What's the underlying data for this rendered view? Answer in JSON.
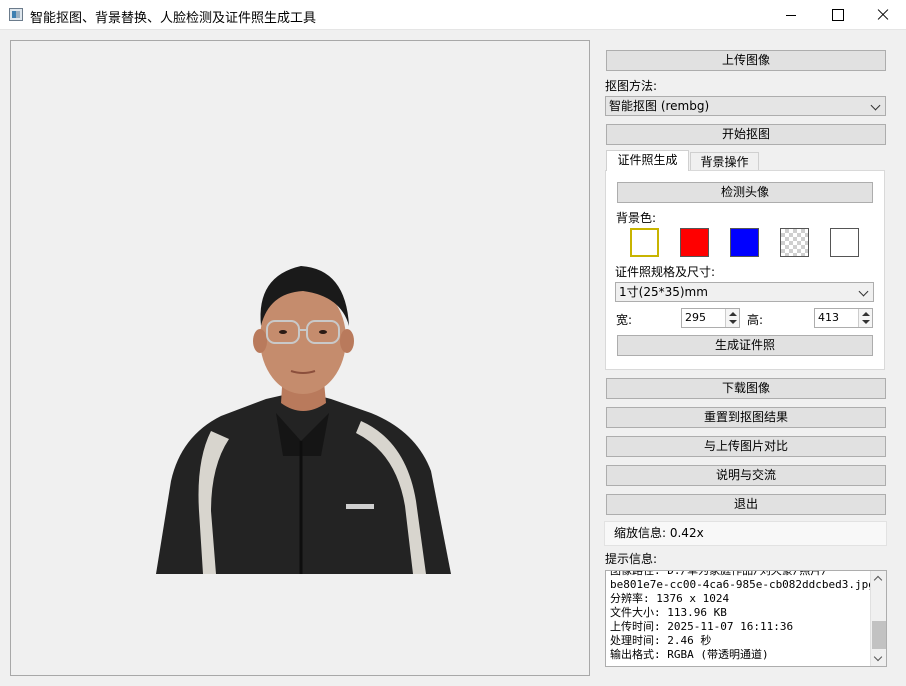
{
  "window": {
    "title": "智能抠图、背景替换、人脸检测及证件照生成工具"
  },
  "controls": {
    "upload_label": "上传图像",
    "matting_method_label": "抠图方法:",
    "matting_method_value": "智能抠图 (rembg)",
    "start_matting_label": "开始抠图"
  },
  "tabs": [
    {
      "label": "证件照生成",
      "active": true
    },
    {
      "label": "背景操作",
      "active": false
    }
  ],
  "id_photo": {
    "detect_label": "检测头像",
    "bg_color_label": "背景色:",
    "swatches": [
      {
        "name": "white",
        "color": "#ffffff",
        "selected": true
      },
      {
        "name": "red",
        "color": "#ff0000",
        "selected": false
      },
      {
        "name": "blue",
        "color": "#0000ff",
        "selected": false
      },
      {
        "name": "transparent",
        "color": "transparent",
        "selected": false
      },
      {
        "name": "white",
        "color": "#ffffff",
        "selected": false
      }
    ],
    "spec_label": "证件照规格及尺寸:",
    "spec_value": "1寸(25*35)mm",
    "width_label": "宽:",
    "width_value": "295",
    "height_label": "高:",
    "height_value": "413",
    "generate_label": "生成证件照"
  },
  "actions": {
    "download_label": "下载图像",
    "reset_label": "重置到抠图结果",
    "compare_label": "与上传图片对比",
    "help_label": "说明与交流",
    "exit_label": "退出"
  },
  "zoom_info": "缩放信息: 0.42x",
  "log": {
    "label": "提示信息:",
    "lines": [
      "图像路径: D:/草为家庭作品/刘天豪/照片/",
      "be801e7e-cc00-4ca6-985e-cb082ddcbed3.jpg",
      "分辨率: 1376 x 1024",
      "文件大小: 113.96 KB",
      "上传时间: 2025-11-07 16:11:36",
      "处理时间: 2.46 秒",
      "输出格式: RGBA (带透明通道)"
    ]
  },
  "colors": {
    "selected_swatch_border": "#c8b400",
    "button_face": "#e1e1e1"
  }
}
